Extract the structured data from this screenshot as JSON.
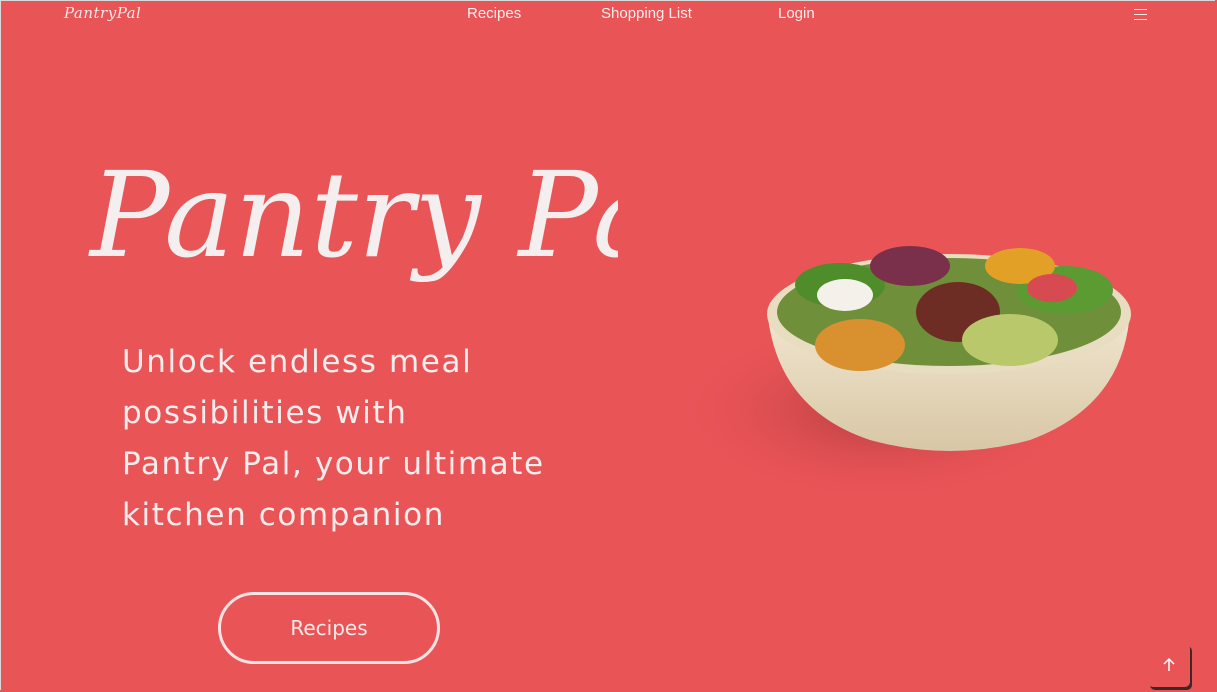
{
  "brand": {
    "logo_text": "PantryPal",
    "hero_title": "Pantry Pal"
  },
  "nav": {
    "items": [
      {
        "label": "Recipes"
      },
      {
        "label": "Shopping List"
      },
      {
        "label": "Login"
      }
    ],
    "menu_icon": "hamburger-icon"
  },
  "hero": {
    "tagline_lines": [
      "Unlock endless meal",
      "possibilities with",
      "Pantry Pal, your ultimate",
      "kitchen companion"
    ],
    "cta_label": "Recipes",
    "image_icon": "salad-bowl-image"
  },
  "scroll_top": {
    "icon": "arrow-up-icon"
  },
  "colors": {
    "background": "#e95457",
    "text": "#f6eeee",
    "bowl": "#efe3cc"
  }
}
